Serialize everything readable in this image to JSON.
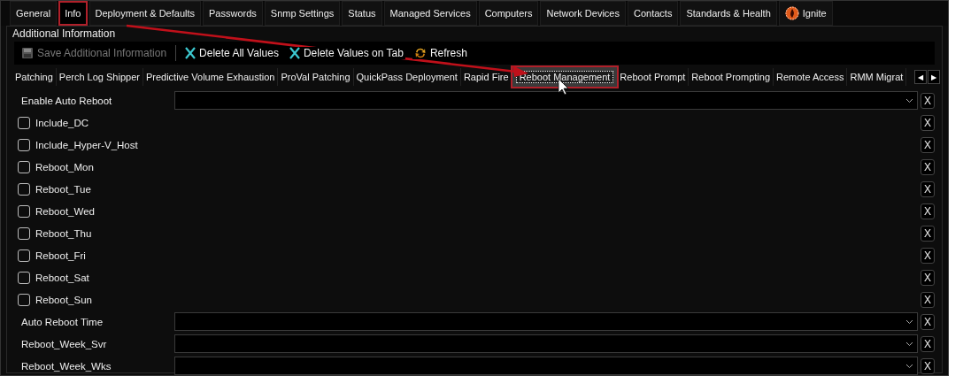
{
  "main_tabs": [
    {
      "label": "General",
      "selected": false,
      "highlighted": false
    },
    {
      "label": "Info",
      "selected": true,
      "highlighted": true
    },
    {
      "label": "Deployment & Defaults",
      "selected": false,
      "highlighted": false
    },
    {
      "label": "Passwords",
      "selected": false,
      "highlighted": false
    },
    {
      "label": "Snmp Settings",
      "selected": false,
      "highlighted": false
    },
    {
      "label": "Status",
      "selected": false,
      "highlighted": false
    },
    {
      "label": "Managed Services",
      "selected": false,
      "highlighted": false
    },
    {
      "label": "Computers",
      "selected": false,
      "highlighted": false
    },
    {
      "label": "Network Devices",
      "selected": false,
      "highlighted": false
    },
    {
      "label": "Contacts",
      "selected": false,
      "highlighted": false
    },
    {
      "label": "Standards & Health",
      "selected": false,
      "highlighted": false
    },
    {
      "label": "Ignite",
      "selected": false,
      "highlighted": false,
      "kind": "logo"
    }
  ],
  "group_title": "Additional Information",
  "toolbar": [
    {
      "label": "Save Additional Information",
      "kind": "save",
      "disabled": true
    },
    {
      "label": "Delete All Values",
      "kind": "delete",
      "disabled": false
    },
    {
      "label": "Delete Values on Tab",
      "kind": "delete",
      "disabled": false
    },
    {
      "label": "Refresh",
      "kind": "refresh",
      "disabled": false
    }
  ],
  "sub_tabs": [
    {
      "label": "Patching",
      "selected": false,
      "highlighted": false
    },
    {
      "label": "Perch Log Shipper",
      "selected": false,
      "highlighted": false
    },
    {
      "label": "Predictive Volume Exhaustion",
      "selected": false,
      "highlighted": false
    },
    {
      "label": "ProVal Patching",
      "selected": false,
      "highlighted": false
    },
    {
      "label": "QuickPass Deployment",
      "selected": false,
      "highlighted": false
    },
    {
      "label": "Rapid Fire",
      "selected": false,
      "highlighted": false
    },
    {
      "label": "Reboot Management",
      "selected": true,
      "highlighted": true
    },
    {
      "label": "Reboot Prompt",
      "selected": false,
      "highlighted": false
    },
    {
      "label": "Reboot Prompting",
      "selected": false,
      "highlighted": false
    },
    {
      "label": "Remote Access",
      "selected": false,
      "highlighted": false
    },
    {
      "label": "RMM Migrat",
      "selected": false,
      "highlighted": false
    }
  ],
  "scroll_buttons": [
    "◀",
    "▶"
  ],
  "fields": [
    {
      "label": "Enable Auto Reboot",
      "kind": "dropdown",
      "clear": "X"
    },
    {
      "label": "Include_DC",
      "kind": "checkbox",
      "checked": false,
      "clear": "X"
    },
    {
      "label": "Include_Hyper-V_Host",
      "kind": "checkbox",
      "checked": false,
      "clear": "X"
    },
    {
      "label": "Reboot_Mon",
      "kind": "checkbox",
      "checked": false,
      "clear": "X"
    },
    {
      "label": "Reboot_Tue",
      "kind": "checkbox",
      "checked": false,
      "clear": "X"
    },
    {
      "label": "Reboot_Wed",
      "kind": "checkbox",
      "checked": false,
      "clear": "X"
    },
    {
      "label": "Reboot_Thu",
      "kind": "checkbox",
      "checked": false,
      "clear": "X"
    },
    {
      "label": "Reboot_Fri",
      "kind": "checkbox",
      "checked": false,
      "clear": "X"
    },
    {
      "label": "Reboot_Sat",
      "kind": "checkbox",
      "checked": false,
      "clear": "X"
    },
    {
      "label": "Reboot_Sun",
      "kind": "checkbox",
      "checked": false,
      "clear": "X"
    },
    {
      "label": "Auto Reboot Time",
      "kind": "dropdown",
      "clear": "X"
    },
    {
      "label": "Reboot_Week_Svr",
      "kind": "dropdown",
      "clear": "X"
    },
    {
      "label": "Reboot_Week_Wks",
      "kind": "dropdown",
      "clear": "X"
    }
  ]
}
